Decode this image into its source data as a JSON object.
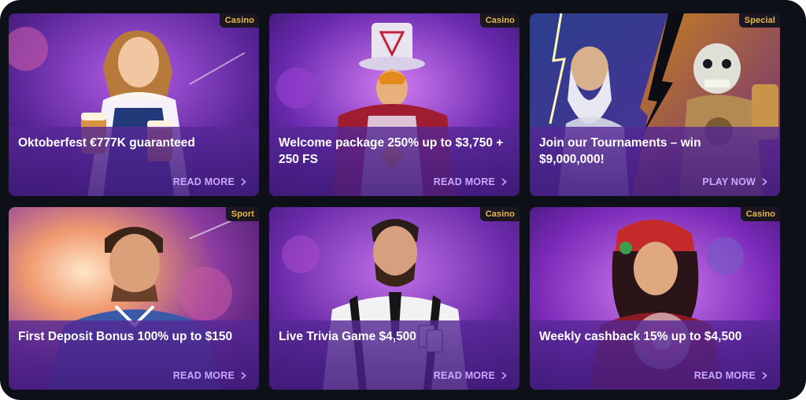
{
  "colors": {
    "background": "#0d1016",
    "badge_text": "#e6b949",
    "cta_text": "#c9a7ff",
    "panel": "#56289a"
  },
  "cards": [
    {
      "badge": "Casino",
      "title": "Oktoberfest €777K guaranteed",
      "cta": "READ MORE",
      "art": "oktoberfest-waitress"
    },
    {
      "badge": "Casino",
      "title": "Welcome package 250% up to $3,750 + 250 FS",
      "cta": "READ MORE",
      "art": "magician-top-hat"
    },
    {
      "badge": "Special",
      "title": "Join our Tournaments – win $9,000,000!",
      "cta": "PLAY NOW",
      "art": "zeus-vs-skeleton"
    },
    {
      "badge": "Sport",
      "title": "First Deposit Bonus 100% up to $150",
      "cta": "READ MORE",
      "art": "football-player"
    },
    {
      "badge": "Casino",
      "title": "Live Trivia Game $4,500",
      "cta": "READ MORE",
      "art": "game-host-with-cards"
    },
    {
      "badge": "Casino",
      "title": "Weekly cashback 15% up to $4,500",
      "cta": "READ MORE",
      "art": "fortune-teller"
    }
  ]
}
